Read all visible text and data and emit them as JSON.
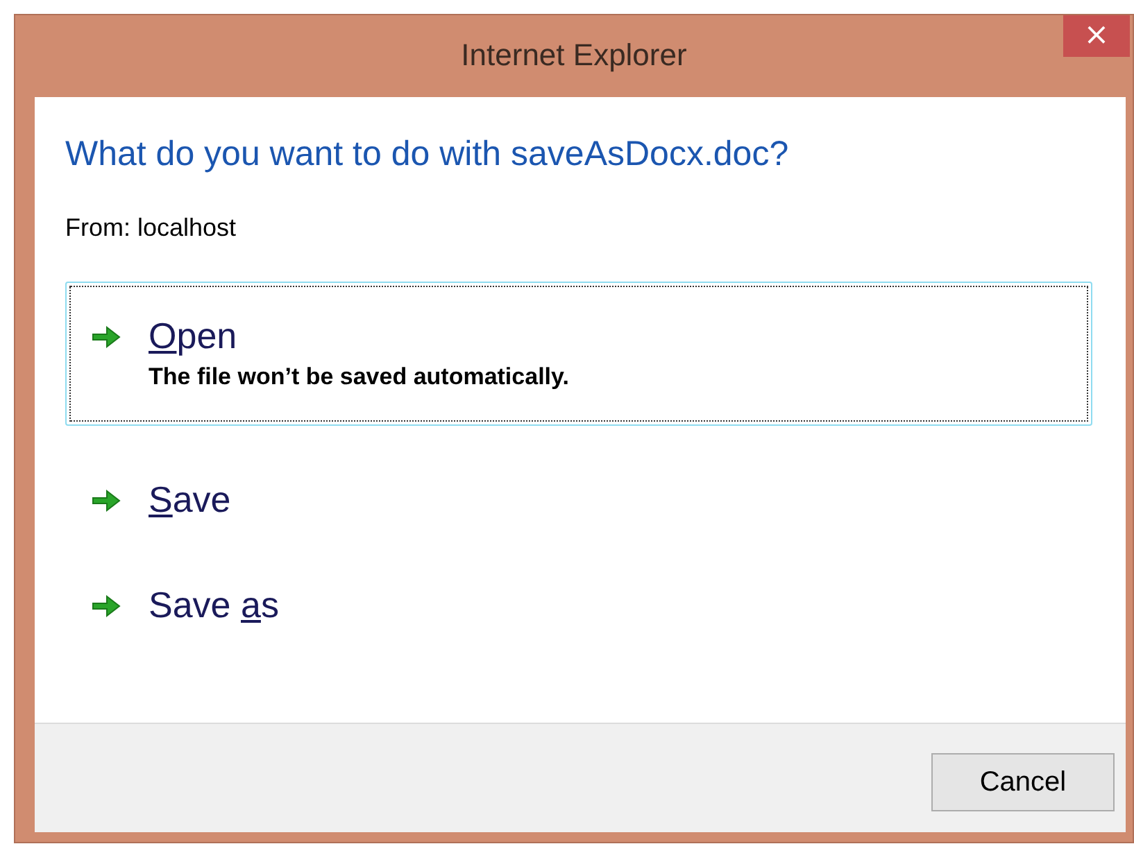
{
  "window": {
    "title": "Internet Explorer",
    "close": "×"
  },
  "heading": "What do you want to do with saveAsDocx.doc?",
  "source": "From: localhost",
  "options": [
    {
      "key": "O",
      "after": "pen",
      "description": "The file won’t be saved automatically.",
      "selected": true
    },
    {
      "key": "S",
      "after": "ave",
      "selected": false
    },
    {
      "before": "Save ",
      "key": "a",
      "after": "s",
      "selected": false
    }
  ],
  "buttons": [
    "Cancel"
  ]
}
